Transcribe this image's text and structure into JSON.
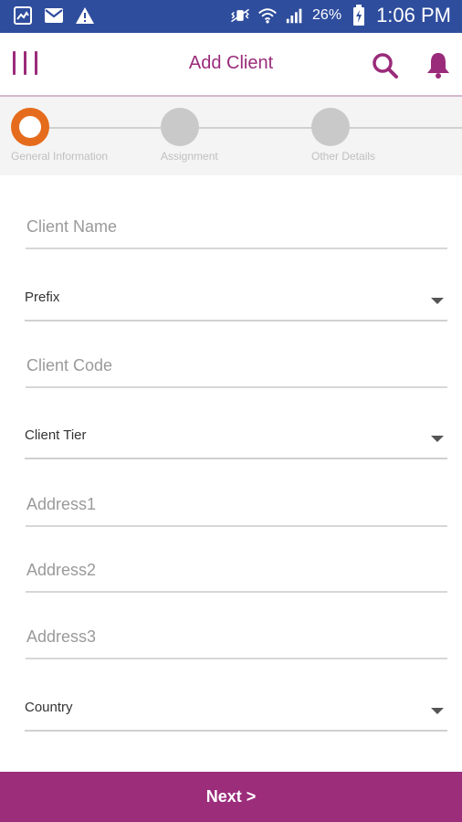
{
  "status_bar": {
    "battery_percent": "26%",
    "time": "1:06 PM",
    "icons": [
      "image-icon",
      "gmail-icon",
      "warning-icon",
      "vibrate-icon",
      "wifi-icon",
      "signal-icon",
      "battery-charging-icon"
    ]
  },
  "app_bar": {
    "title": "Add Client",
    "icons": [
      "menu-icon",
      "search-icon",
      "bell-icon"
    ],
    "accent_color": "#9a2b7a"
  },
  "stepper": {
    "steps": [
      {
        "label": "General Information",
        "active": true
      },
      {
        "label": "Assignment",
        "active": false
      },
      {
        "label": "Other Details",
        "active": false
      }
    ],
    "active_color": "#e56c1c"
  },
  "form": {
    "client_name_placeholder": "Client Name",
    "prefix_label": "Prefix",
    "client_code_placeholder": "Client Code",
    "client_tier_label": "Client Tier",
    "address1_placeholder": "Address1",
    "address2_placeholder": "Address2",
    "address3_placeholder": "Address3",
    "country_label": "Country"
  },
  "footer": {
    "next_label": "Next >",
    "color": "#9c2d7b"
  }
}
